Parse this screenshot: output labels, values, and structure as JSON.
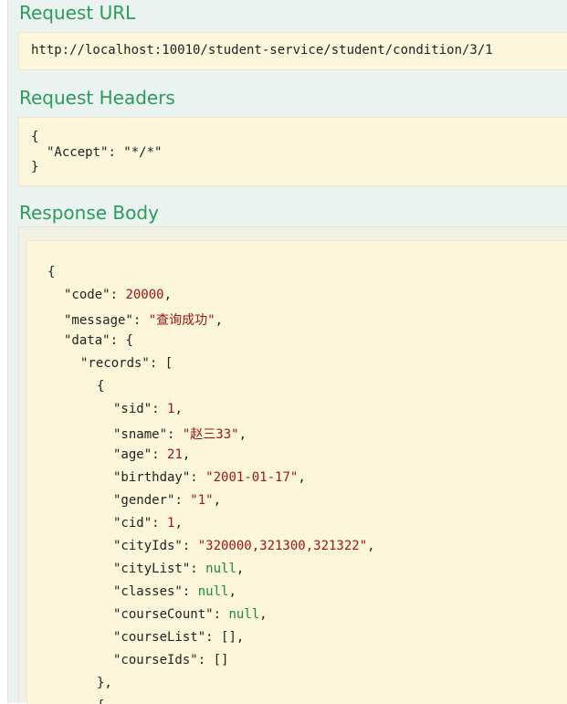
{
  "sections": {
    "request_url": {
      "title": "Request URL",
      "url": "http://localhost:10010/student-service/student/condition/3/1"
    },
    "request_headers": {
      "title": "Request Headers",
      "open": "{",
      "key": "\"Accept\"",
      "value": "\"*/*\"",
      "close": "}"
    },
    "response_body": {
      "title": "Response Body",
      "lines": {
        "l0": "{",
        "code_key": "\"code\"",
        "code_val": "20000",
        "message_key": "\"message\"",
        "message_val": "\"查询成功\"",
        "data_key": "\"data\"",
        "data_open": "{",
        "records_key": "\"records\"",
        "records_open": "[",
        "obj_open": "{",
        "sid_key": "\"sid\"",
        "sid_val": "1",
        "sname_key": "\"sname\"",
        "sname_val": "\"赵三33\"",
        "age_key": "\"age\"",
        "age_val": "21",
        "birthday_key": "\"birthday\"",
        "birthday_val": "\"2001-01-17\"",
        "gender_key": "\"gender\"",
        "gender_val": "\"1\"",
        "cid_key": "\"cid\"",
        "cid_val": "1",
        "cityIds_key": "\"cityIds\"",
        "cityIds_val": "\"320000,321300,321322\"",
        "cityList_key": "\"cityList\"",
        "cityList_val": "null",
        "classes_key": "\"classes\"",
        "classes_val": "null",
        "courseCount_key": "\"courseCount\"",
        "courseCount_val": "null",
        "courseList_key": "\"courseList\"",
        "courseList_val": "[]",
        "courseIds_key": "\"courseIds\"",
        "courseIds_val": "[]",
        "obj_close": "},",
        "next_obj_open": "{"
      }
    }
  }
}
